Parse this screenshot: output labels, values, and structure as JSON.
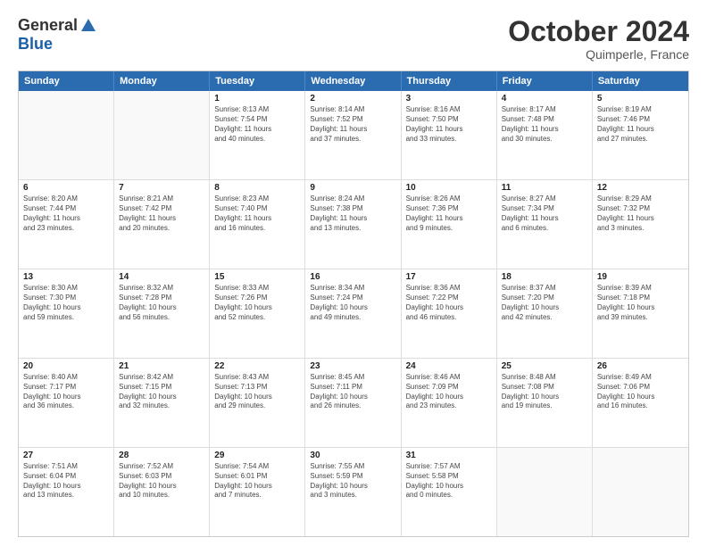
{
  "header": {
    "logo_general": "General",
    "logo_blue": "Blue",
    "month_title": "October 2024",
    "location": "Quimperle, France"
  },
  "weekdays": [
    "Sunday",
    "Monday",
    "Tuesday",
    "Wednesday",
    "Thursday",
    "Friday",
    "Saturday"
  ],
  "rows": [
    [
      {
        "day": "",
        "info": ""
      },
      {
        "day": "",
        "info": ""
      },
      {
        "day": "1",
        "info": "Sunrise: 8:13 AM\nSunset: 7:54 PM\nDaylight: 11 hours\nand 40 minutes."
      },
      {
        "day": "2",
        "info": "Sunrise: 8:14 AM\nSunset: 7:52 PM\nDaylight: 11 hours\nand 37 minutes."
      },
      {
        "day": "3",
        "info": "Sunrise: 8:16 AM\nSunset: 7:50 PM\nDaylight: 11 hours\nand 33 minutes."
      },
      {
        "day": "4",
        "info": "Sunrise: 8:17 AM\nSunset: 7:48 PM\nDaylight: 11 hours\nand 30 minutes."
      },
      {
        "day": "5",
        "info": "Sunrise: 8:19 AM\nSunset: 7:46 PM\nDaylight: 11 hours\nand 27 minutes."
      }
    ],
    [
      {
        "day": "6",
        "info": "Sunrise: 8:20 AM\nSunset: 7:44 PM\nDaylight: 11 hours\nand 23 minutes."
      },
      {
        "day": "7",
        "info": "Sunrise: 8:21 AM\nSunset: 7:42 PM\nDaylight: 11 hours\nand 20 minutes."
      },
      {
        "day": "8",
        "info": "Sunrise: 8:23 AM\nSunset: 7:40 PM\nDaylight: 11 hours\nand 16 minutes."
      },
      {
        "day": "9",
        "info": "Sunrise: 8:24 AM\nSunset: 7:38 PM\nDaylight: 11 hours\nand 13 minutes."
      },
      {
        "day": "10",
        "info": "Sunrise: 8:26 AM\nSunset: 7:36 PM\nDaylight: 11 hours\nand 9 minutes."
      },
      {
        "day": "11",
        "info": "Sunrise: 8:27 AM\nSunset: 7:34 PM\nDaylight: 11 hours\nand 6 minutes."
      },
      {
        "day": "12",
        "info": "Sunrise: 8:29 AM\nSunset: 7:32 PM\nDaylight: 11 hours\nand 3 minutes."
      }
    ],
    [
      {
        "day": "13",
        "info": "Sunrise: 8:30 AM\nSunset: 7:30 PM\nDaylight: 10 hours\nand 59 minutes."
      },
      {
        "day": "14",
        "info": "Sunrise: 8:32 AM\nSunset: 7:28 PM\nDaylight: 10 hours\nand 56 minutes."
      },
      {
        "day": "15",
        "info": "Sunrise: 8:33 AM\nSunset: 7:26 PM\nDaylight: 10 hours\nand 52 minutes."
      },
      {
        "day": "16",
        "info": "Sunrise: 8:34 AM\nSunset: 7:24 PM\nDaylight: 10 hours\nand 49 minutes."
      },
      {
        "day": "17",
        "info": "Sunrise: 8:36 AM\nSunset: 7:22 PM\nDaylight: 10 hours\nand 46 minutes."
      },
      {
        "day": "18",
        "info": "Sunrise: 8:37 AM\nSunset: 7:20 PM\nDaylight: 10 hours\nand 42 minutes."
      },
      {
        "day": "19",
        "info": "Sunrise: 8:39 AM\nSunset: 7:18 PM\nDaylight: 10 hours\nand 39 minutes."
      }
    ],
    [
      {
        "day": "20",
        "info": "Sunrise: 8:40 AM\nSunset: 7:17 PM\nDaylight: 10 hours\nand 36 minutes."
      },
      {
        "day": "21",
        "info": "Sunrise: 8:42 AM\nSunset: 7:15 PM\nDaylight: 10 hours\nand 32 minutes."
      },
      {
        "day": "22",
        "info": "Sunrise: 8:43 AM\nSunset: 7:13 PM\nDaylight: 10 hours\nand 29 minutes."
      },
      {
        "day": "23",
        "info": "Sunrise: 8:45 AM\nSunset: 7:11 PM\nDaylight: 10 hours\nand 26 minutes."
      },
      {
        "day": "24",
        "info": "Sunrise: 8:46 AM\nSunset: 7:09 PM\nDaylight: 10 hours\nand 23 minutes."
      },
      {
        "day": "25",
        "info": "Sunrise: 8:48 AM\nSunset: 7:08 PM\nDaylight: 10 hours\nand 19 minutes."
      },
      {
        "day": "26",
        "info": "Sunrise: 8:49 AM\nSunset: 7:06 PM\nDaylight: 10 hours\nand 16 minutes."
      }
    ],
    [
      {
        "day": "27",
        "info": "Sunrise: 7:51 AM\nSunset: 6:04 PM\nDaylight: 10 hours\nand 13 minutes."
      },
      {
        "day": "28",
        "info": "Sunrise: 7:52 AM\nSunset: 6:03 PM\nDaylight: 10 hours\nand 10 minutes."
      },
      {
        "day": "29",
        "info": "Sunrise: 7:54 AM\nSunset: 6:01 PM\nDaylight: 10 hours\nand 7 minutes."
      },
      {
        "day": "30",
        "info": "Sunrise: 7:55 AM\nSunset: 5:59 PM\nDaylight: 10 hours\nand 3 minutes."
      },
      {
        "day": "31",
        "info": "Sunrise: 7:57 AM\nSunset: 5:58 PM\nDaylight: 10 hours\nand 0 minutes."
      },
      {
        "day": "",
        "info": ""
      },
      {
        "day": "",
        "info": ""
      }
    ]
  ]
}
